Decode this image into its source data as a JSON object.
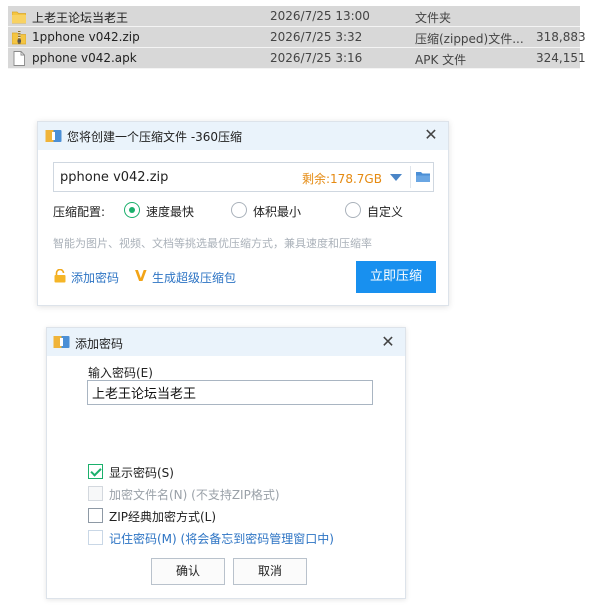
{
  "files": [
    {
      "name": "上老王论坛当老王",
      "date": "2026/7/25 13:00",
      "type": "文件夹",
      "size": "",
      "icon": "folder-icon"
    },
    {
      "name": "1pphone v042.zip",
      "date": "2026/7/25 3:32",
      "type": "压缩(zipped)文件...",
      "size": "318,883",
      "icon": "zip-icon"
    },
    {
      "name": "pphone v042.apk",
      "date": "2026/7/25 3:16",
      "type": "APK 文件",
      "size": "324,151",
      "icon": "file-icon"
    }
  ],
  "compress_dialog": {
    "title": "您将创建一个压缩文件 -360压缩",
    "filename": "pphone v042.zip",
    "remaining": "剩余:178.7GB",
    "config_label": "压缩配置:",
    "options": [
      {
        "label": "速度最快",
        "selected": true
      },
      {
        "label": "体积最小",
        "selected": false
      },
      {
        "label": "自定义",
        "selected": false
      }
    ],
    "hint": "智能为图片、视频、文档等挑选最优压缩方式，兼具速度和压缩率",
    "add_password_link": "添加密码",
    "super_package_link": "生成超级压缩包",
    "compress_button": "立即压缩",
    "accent": "#1890ef"
  },
  "password_dialog": {
    "title": "添加密码",
    "input_label": "输入密码(E)",
    "password_value": "上老王论坛当老王",
    "checkboxes": [
      {
        "label": "显示密码(S)",
        "checked": true,
        "enabled": true
      },
      {
        "label": "加密文件名(N) (不支持ZIP格式)",
        "checked": false,
        "enabled": false
      },
      {
        "label": "ZIP经典加密方式(L)",
        "checked": false,
        "enabled": true
      },
      {
        "label": "记住密码(M) (将会备忘到密码管理窗口中)",
        "checked": false,
        "enabled": true
      }
    ],
    "ok_button": "确认",
    "cancel_button": "取消"
  }
}
